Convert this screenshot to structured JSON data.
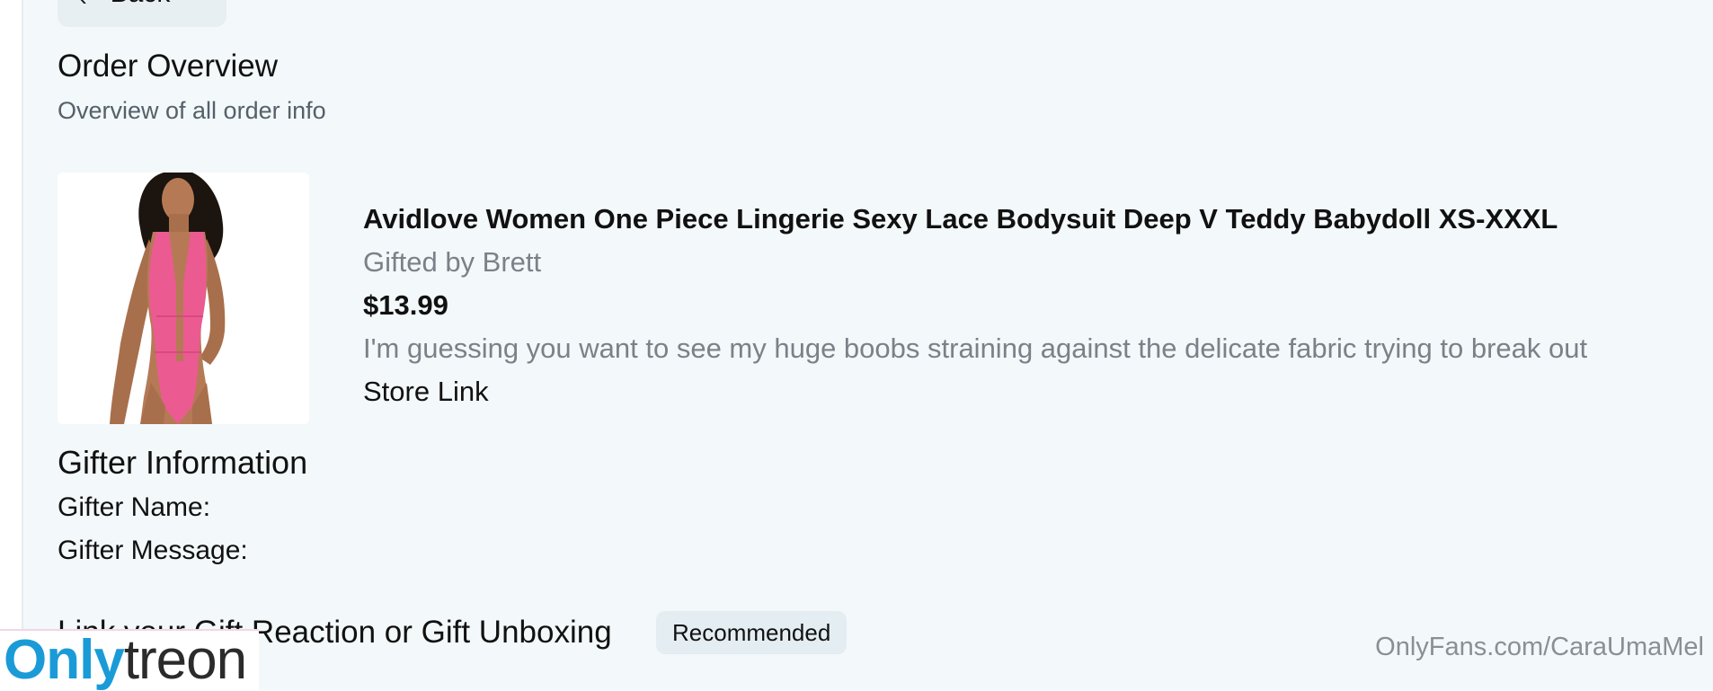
{
  "nav": {
    "back_label": "Back",
    "back_icon": "chevron-left-icon"
  },
  "page": {
    "title": "Order Overview",
    "subtitle": "Overview of all order info"
  },
  "product": {
    "title": "Avidlove Women One Piece Lingerie Sexy Lace Bodysuit Deep V Teddy Babydoll XS-XXXL",
    "gifted_by": "Gifted by Brett",
    "price": "$13.99",
    "description": "I'm guessing you want to see my huge boobs straining against the delicate fabric trying to break out",
    "store_link_label": "Store Link",
    "image_colors": {
      "garment": "#ec5a92",
      "skin": "#b57a55",
      "hair": "#1c140f"
    }
  },
  "gifter": {
    "section_title": "Gifter Information",
    "name_label": "Gifter Name:",
    "message_label": "Gifter Message:"
  },
  "reaction": {
    "title": "Link your Gift Reaction or Gift Unboxing",
    "badge": "Recommended"
  },
  "watermark": {
    "logo_part1": "Only",
    "logo_part2": "treon",
    "site": "OnlyFans.com/CaraUmaMel"
  },
  "colors": {
    "background": "#f3f8fa",
    "muted_text": "#7a8188",
    "badge_bg": "#e4edf1",
    "logo_blue": "#1a9bd7"
  }
}
